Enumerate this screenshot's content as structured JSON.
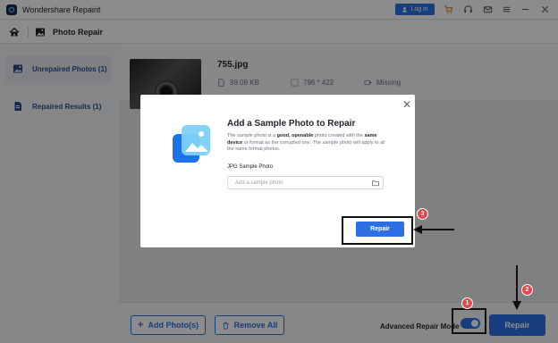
{
  "app": {
    "title": "Wondershare Repairit",
    "login_label": "Log in"
  },
  "breadcrumb": {
    "title": "Photo Repair"
  },
  "sidebar": {
    "items": [
      {
        "label": "Unrepaired Photos (1)",
        "icon": "photo-icon",
        "active": true
      },
      {
        "label": "Repaired Results (1)",
        "icon": "document-icon",
        "active": false
      }
    ]
  },
  "file": {
    "name": "755.jpg",
    "size": "99.09  KB",
    "resolution": "796 * 422",
    "status": "Missing"
  },
  "bottombar": {
    "add_label": "Add Photo(s)",
    "remove_label": "Remove All",
    "advanced_label": "Advanced Repair Mode",
    "repair_label": "Repair"
  },
  "modal": {
    "title": "Add a Sample Photo to Repair",
    "desc_parts": {
      "p1": "The sample photo is a ",
      "b1": "good, openable",
      "p2": " photo created with the ",
      "b2": "same device",
      "p3": " or format as the corrupted one. The sample photo will apply to all the same format photos."
    },
    "sample_label": "JPG Sample Photo",
    "input_placeholder": "Add a sample photo",
    "repair_label": "Repair",
    "close_glyph": "✕"
  },
  "annotations": {
    "badge1": "1",
    "badge2": "2",
    "badge3": "3"
  },
  "colors": {
    "accent": "#2b6fe3",
    "badge": "#e5484d"
  }
}
